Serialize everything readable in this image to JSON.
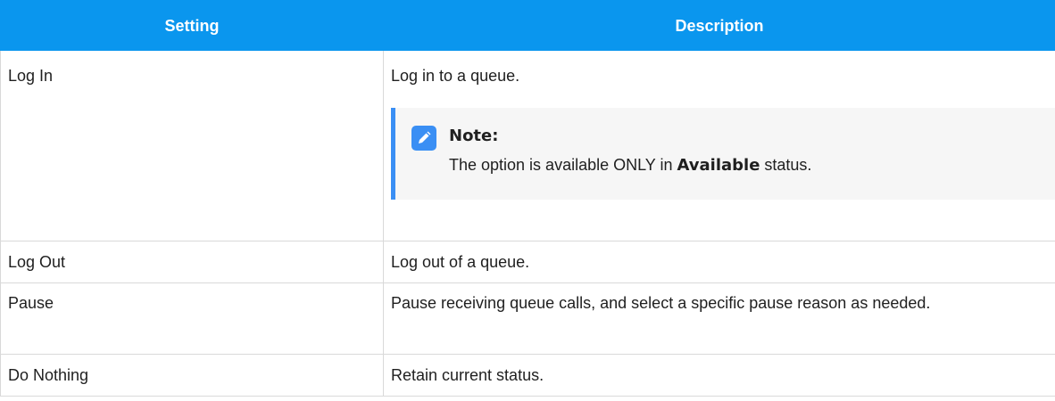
{
  "table": {
    "headers": {
      "setting": "Setting",
      "description": "Description"
    },
    "rows": [
      {
        "setting": "Log In",
        "description": "Log in to a queue.",
        "note": {
          "icon": "pencil-icon",
          "title": "Note:",
          "text_before": "The option is available ONLY in ",
          "text_strong": "Available",
          "text_after": " status."
        }
      },
      {
        "setting": "Log Out",
        "description": "Log out of a queue."
      },
      {
        "setting": "Pause",
        "description": "Pause receiving queue calls, and select a specific pause reason as needed."
      },
      {
        "setting": "Do Nothing",
        "description": "Retain current status."
      }
    ]
  },
  "colors": {
    "header_bg": "#0a96ee",
    "note_accent": "#3a8ff4",
    "note_bg": "#f6f6f6"
  }
}
